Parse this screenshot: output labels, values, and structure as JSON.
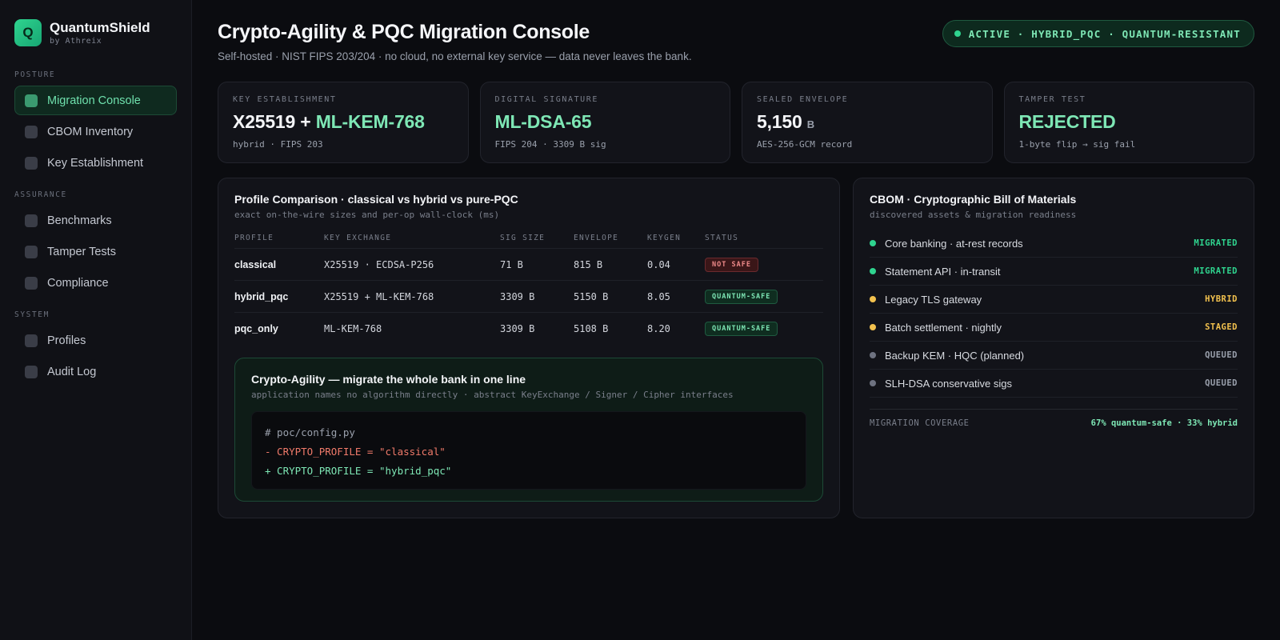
{
  "brand": {
    "logo": "Q",
    "name": "QuantumShield",
    "sub": "by Athreix"
  },
  "nav": [
    {
      "section": "POSTURE",
      "items": [
        {
          "label": "Migration Console",
          "active": true
        },
        {
          "label": "CBOM Inventory",
          "active": false
        },
        {
          "label": "Key Establishment",
          "active": false
        }
      ]
    },
    {
      "section": "ASSURANCE",
      "items": [
        {
          "label": "Benchmarks",
          "active": false
        },
        {
          "label": "Tamper Tests",
          "active": false
        },
        {
          "label": "Compliance",
          "active": false
        }
      ]
    },
    {
      "section": "SYSTEM",
      "items": [
        {
          "label": "Profiles",
          "active": false
        },
        {
          "label": "Audit Log",
          "active": false
        }
      ]
    }
  ],
  "header": {
    "title": "Crypto-Agility & PQC Migration Console",
    "subtitle": "Self-hosted · NIST FIPS 203/204 · no cloud, no external key service — data never leaves the bank.",
    "status": "ACTIVE · HYBRID_PQC · QUANTUM-RESISTANT"
  },
  "cards": [
    {
      "label": "KEY ESTABLISHMENT",
      "value_plain": "X25519 + ",
      "value_accent": "ML-KEM-768",
      "unit": "",
      "foot": "hybrid · FIPS 203"
    },
    {
      "label": "DIGITAL SIGNATURE",
      "value_plain": "",
      "value_accent": "ML-DSA-65",
      "unit": "",
      "foot": "FIPS 204 · 3309 B sig"
    },
    {
      "label": "SEALED ENVELOPE",
      "value_plain": "5,150",
      "value_accent": "",
      "unit": "B",
      "foot": "AES-256-GCM record"
    },
    {
      "label": "TAMPER TEST",
      "value_plain": "",
      "value_accent": "REJECTED",
      "unit": "",
      "foot": "1-byte flip → sig fail"
    }
  ],
  "comparison": {
    "title": "Profile Comparison · classical vs hybrid vs pure-PQC",
    "subtitle": "exact on-the-wire sizes and per-op wall-clock (ms)",
    "columns": [
      "PROFILE",
      "KEY EXCHANGE",
      "SIG SIZE",
      "ENVELOPE",
      "KEYGEN",
      "STATUS"
    ],
    "rows": [
      {
        "profile": "classical",
        "kex": "X25519 · ECDSA-P256",
        "sig": "71 B",
        "env": "815 B",
        "keygen": "0.04",
        "status": "NOT SAFE",
        "safe": false
      },
      {
        "profile": "hybrid_pqc",
        "kex": "X25519 + ML-KEM-768",
        "sig": "3309 B",
        "env": "5150 B",
        "keygen": "8.05",
        "status": "QUANTUM-SAFE",
        "safe": true
      },
      {
        "profile": "pqc_only",
        "kex": "ML-KEM-768",
        "sig": "3309 B",
        "env": "5108 B",
        "keygen": "8.20",
        "status": "QUANTUM-SAFE",
        "safe": true
      }
    ]
  },
  "agility": {
    "title": "Crypto-Agility — migrate the whole bank in one line",
    "subtitle": "application names no algorithm directly · abstract KeyExchange / Signer / Cipher interfaces",
    "code": [
      "# poc/config.py",
      "- CRYPTO_PROFILE = \"classical\"",
      "+ CRYPTO_PROFILE = \"hybrid_pqc\""
    ]
  },
  "cbom": {
    "title": "CBOM · Cryptographic Bill of Materials",
    "subtitle": "discovered assets & migration readiness",
    "items": [
      {
        "name": "Core banking · at-rest records",
        "status": "MIGRATED",
        "color": "#2fd48f"
      },
      {
        "name": "Statement API · in-transit",
        "status": "MIGRATED",
        "color": "#2fd48f"
      },
      {
        "name": "Legacy TLS gateway",
        "status": "HYBRID",
        "color": "#f2c14e"
      },
      {
        "name": "Batch settlement · nightly",
        "status": "STAGED",
        "color": "#f2c14e"
      },
      {
        "name": "Backup KEM · HQC (planned)",
        "status": "QUEUED",
        "color": "#6e7280"
      },
      {
        "name": "SLH-DSA conservative sigs",
        "status": "QUEUED",
        "color": "#6e7280"
      }
    ],
    "coverage_label": "MIGRATION COVERAGE",
    "coverage_value": "67% quantum-safe · 33% hybrid"
  },
  "colors": {
    "accent": "#7ee7b5",
    "warn": "#f2c14e",
    "danger": "#ef8a8a",
    "muted": "#6e7280"
  }
}
